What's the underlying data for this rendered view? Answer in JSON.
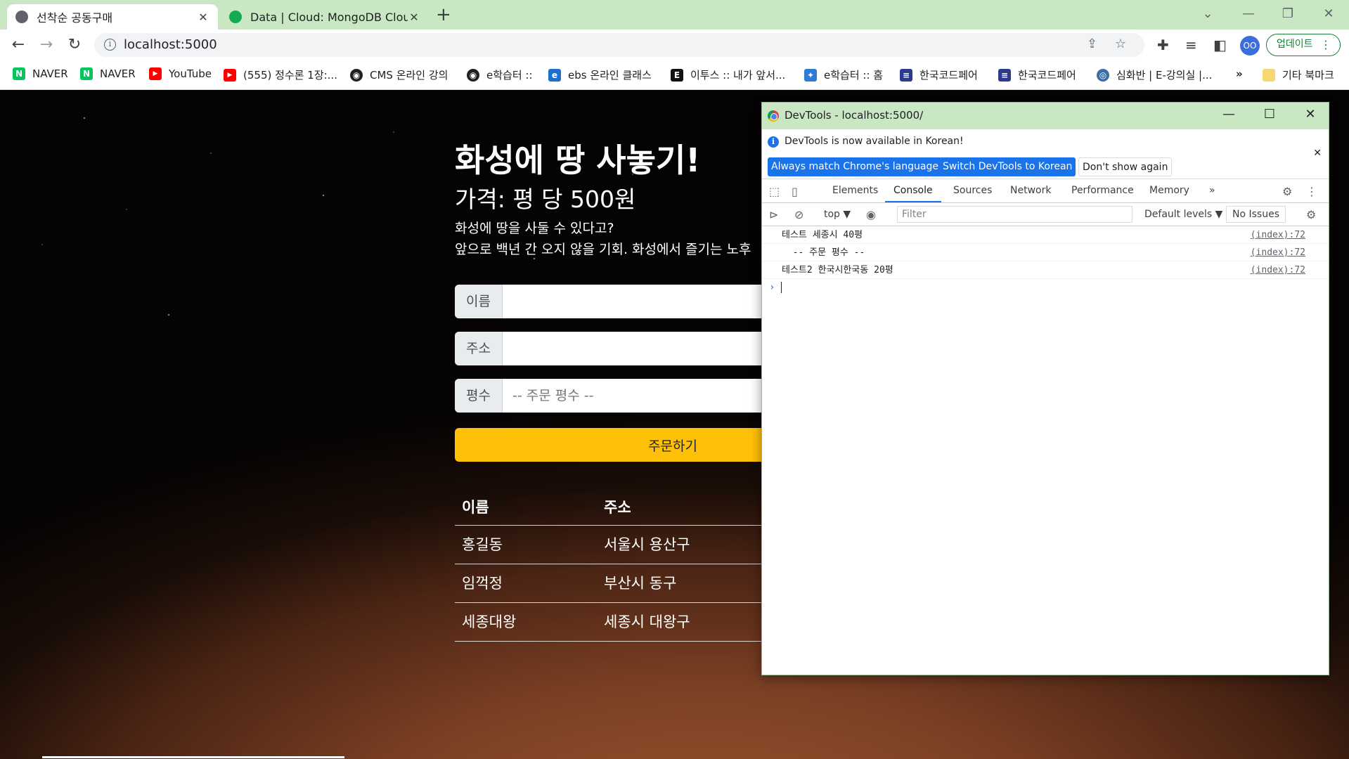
{
  "browser": {
    "tabs": [
      {
        "title": "선착순 공동구매",
        "active": true
      },
      {
        "title": "Data | Cloud: MongoDB Cloud",
        "active": false
      }
    ],
    "url": "localhost:5000",
    "update_label": "업데이트",
    "profile_initials": "OO",
    "bookmarks": [
      {
        "label": "NAVER",
        "color": "#03c75a",
        "glyph": "N"
      },
      {
        "label": "NAVER",
        "color": "#03c75a",
        "glyph": "N"
      },
      {
        "label": "YouTube",
        "color": "#ff0000",
        "glyph": "▶"
      },
      {
        "label": "(555) 정수론 1장:...",
        "color": "#ff0000",
        "glyph": "▶"
      },
      {
        "label": "CMS 온라인 강의",
        "color": "#202124",
        "glyph": "◉"
      },
      {
        "label": "e학습터 ::",
        "color": "#202124",
        "glyph": "◉"
      },
      {
        "label": "ebs 온라인 클래스",
        "color": "#1b6fd1",
        "glyph": "e"
      },
      {
        "label": "이투스 :: 내가 앞서...",
        "color": "#111111",
        "glyph": "E"
      },
      {
        "label": "e학습터 :: 홈",
        "color": "#2e7bd6",
        "glyph": "✦"
      },
      {
        "label": "한국코드페어",
        "color": "#2b3a8f",
        "glyph": "≡"
      },
      {
        "label": "한국코드페어",
        "color": "#2b3a8f",
        "glyph": "≡"
      },
      {
        "label": "심화반 | E-강의실 |...",
        "color": "#3a6ea5",
        "glyph": "◎"
      }
    ],
    "bookmarks_more": "»",
    "other_bookmarks": "기타 북마크"
  },
  "page": {
    "title": "화성에 땅 사놓기!",
    "price": "가격: 평 당 500원",
    "desc1": "화성에 땅을 사둘 수 있다고?",
    "desc2": "앞으로 백년 간 오지 않을 기회. 화성에서 즐기는 노후",
    "form": {
      "name_label": "이름",
      "address_label": "주소",
      "size_label": "평수",
      "size_placeholder": "-- 주문 평수 --",
      "submit_label": "주문하기"
    },
    "table": {
      "headers": [
        "이름",
        "주소"
      ],
      "rows": [
        [
          "홍길동",
          "서울시 용산구"
        ],
        [
          "임꺽정",
          "부산시 동구"
        ],
        [
          "세종대왕",
          "세종시 대왕구"
        ]
      ]
    }
  },
  "devtools": {
    "window_title": "DevTools - localhost:5000/",
    "banner_message": "DevTools is now available in Korean!",
    "banner_buttons": [
      "Always match Chrome's language",
      "Switch DevTools to Korean",
      "Don't show again"
    ],
    "tabs": [
      "Elements",
      "Console",
      "Sources",
      "Network",
      "Performance",
      "Memory"
    ],
    "active_tab": "Console",
    "tabs_more": "»",
    "context": "top ▼",
    "filter_placeholder": "Filter",
    "levels": "Default levels ▼",
    "issues": "No Issues",
    "logs": [
      {
        "message": "테스트 세종시 40평",
        "source": "(index):72"
      },
      {
        "message": "  -- 주문 평수 --",
        "source": "(index):72"
      },
      {
        "message": "테스트2 한국시한국동 20평",
        "source": "(index):72"
      }
    ],
    "prompt": "›"
  }
}
